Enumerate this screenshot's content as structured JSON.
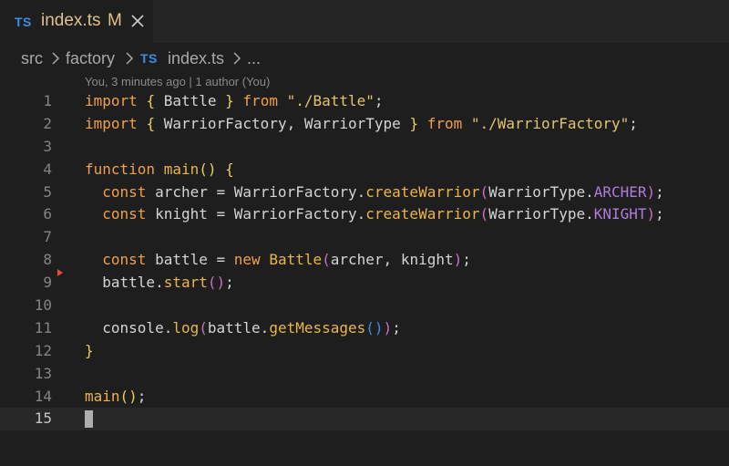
{
  "tab": {
    "badge": "TS",
    "filename": "index.ts",
    "status": "M",
    "close_icon": "close-icon"
  },
  "breadcrumb": {
    "items": [
      "src",
      "factory",
      "index.ts",
      "..."
    ],
    "file_badge": "TS",
    "separator_icon": "chevron-right-icon"
  },
  "codelens": "You, 3 minutes ago | 1 author (You)",
  "colors": {
    "keyword": "#f0a04b",
    "string": "#e3c46b",
    "brace": "#e8d05a",
    "paren": "#c970c9",
    "function": "#e9b64a",
    "enum_member": "#b07bd9",
    "ts_badge": "#3b8eea",
    "modified": "#e2c08d"
  },
  "editor": {
    "line_numbers": [
      "1",
      "2",
      "3",
      "4",
      "5",
      "6",
      "7",
      "8",
      "9",
      "10",
      "11",
      "12",
      "13",
      "14",
      "15"
    ],
    "current_line": 15,
    "lines": [
      [
        [
          "kw",
          "import"
        ],
        [
          "t",
          " "
        ],
        [
          "brace",
          "{"
        ],
        [
          "t",
          " Battle "
        ],
        [
          "brace",
          "}"
        ],
        [
          "t",
          " "
        ],
        [
          "kw",
          "from"
        ],
        [
          "t",
          " "
        ],
        [
          "str",
          "\"./Battle\""
        ],
        [
          "t",
          ";"
        ]
      ],
      [
        [
          "kw",
          "import"
        ],
        [
          "t",
          " "
        ],
        [
          "brace",
          "{"
        ],
        [
          "t",
          " WarriorFactory, WarriorType "
        ],
        [
          "brace",
          "}"
        ],
        [
          "t",
          " "
        ],
        [
          "kw",
          "from"
        ],
        [
          "t",
          " "
        ],
        [
          "str",
          "\"./WarriorFactory\""
        ],
        [
          "t",
          ";"
        ]
      ],
      [],
      [
        [
          "kw",
          "function"
        ],
        [
          "t",
          " "
        ],
        [
          "fn",
          "main"
        ],
        [
          "brace",
          "()"
        ],
        [
          "t",
          " "
        ],
        [
          "brace",
          "{"
        ]
      ],
      [
        [
          "t",
          "  "
        ],
        [
          "kw",
          "const"
        ],
        [
          "t",
          " archer = WarriorFactory."
        ],
        [
          "fn",
          "createWarrior"
        ],
        [
          "paren",
          "("
        ],
        [
          "t",
          "WarriorType."
        ],
        [
          "enum",
          "ARCHER"
        ],
        [
          "paren",
          ")"
        ],
        [
          "t",
          ";"
        ]
      ],
      [
        [
          "t",
          "  "
        ],
        [
          "kw",
          "const"
        ],
        [
          "t",
          " knight = WarriorFactory."
        ],
        [
          "fn",
          "createWarrior"
        ],
        [
          "paren",
          "("
        ],
        [
          "t",
          "WarriorType."
        ],
        [
          "enum",
          "KNIGHT"
        ],
        [
          "paren",
          ")"
        ],
        [
          "t",
          ";"
        ]
      ],
      [],
      [
        [
          "t",
          "  "
        ],
        [
          "kw",
          "const"
        ],
        [
          "t",
          " battle = "
        ],
        [
          "kw",
          "new"
        ],
        [
          "t",
          " "
        ],
        [
          "fn",
          "Battle"
        ],
        [
          "paren",
          "("
        ],
        [
          "t",
          "archer, knight"
        ],
        [
          "paren",
          ")"
        ],
        [
          "t",
          ";"
        ]
      ],
      [
        [
          "t",
          "  battle."
        ],
        [
          "fn",
          "start"
        ],
        [
          "paren",
          "()"
        ],
        [
          "t",
          ";"
        ]
      ],
      [],
      [
        [
          "t",
          "  console."
        ],
        [
          "fn",
          "log"
        ],
        [
          "paren",
          "("
        ],
        [
          "t",
          "battle."
        ],
        [
          "fn",
          "getMessages"
        ],
        [
          "paren2",
          "()"
        ],
        [
          "paren",
          ")"
        ],
        [
          "t",
          ";"
        ]
      ],
      [
        [
          "brace",
          "}"
        ]
      ],
      [],
      [
        [
          "fn",
          "main"
        ],
        [
          "brace",
          "()"
        ],
        [
          "t",
          ";"
        ]
      ],
      []
    ]
  }
}
